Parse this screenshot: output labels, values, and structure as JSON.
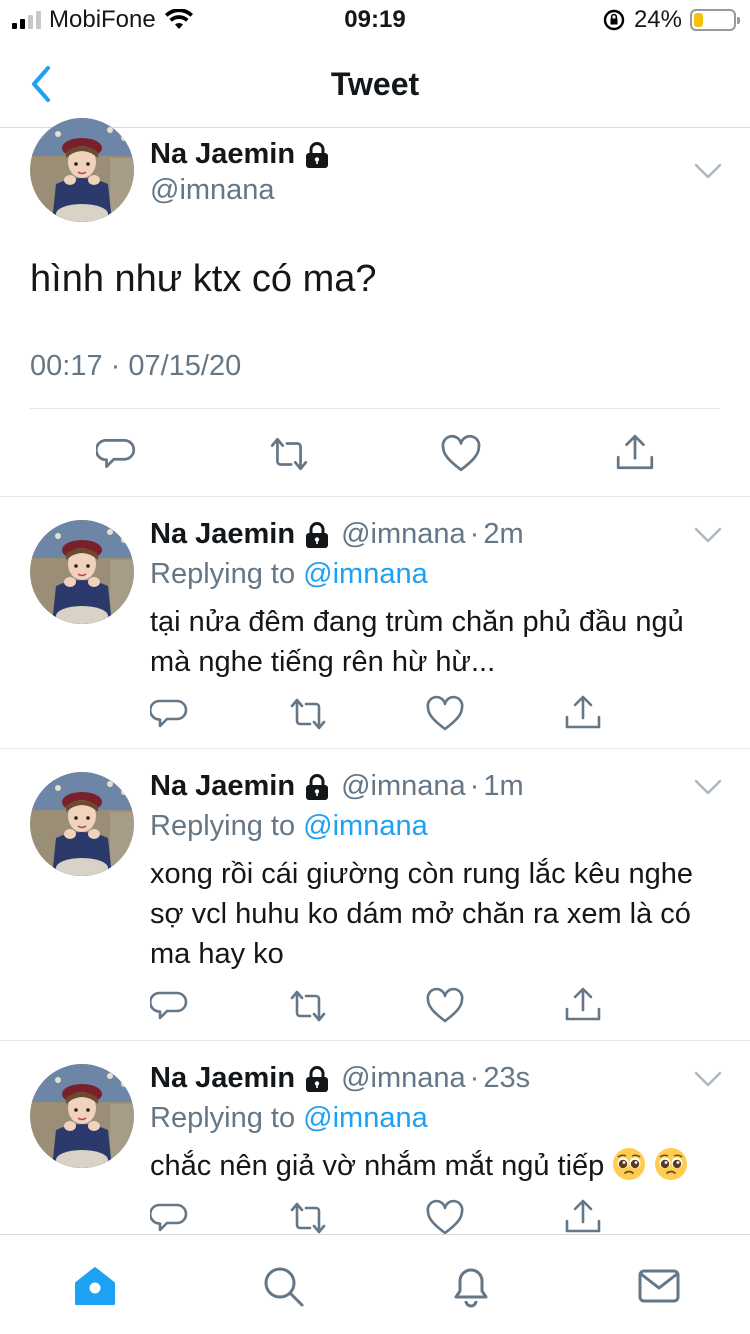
{
  "status_bar": {
    "carrier": "MobiFone",
    "time": "09:19",
    "battery": "24%",
    "battery_level": 0.24
  },
  "nav": {
    "title": "Tweet"
  },
  "main_tweet": {
    "name": "Na Jaemin",
    "handle": "@imnana",
    "text": "hình như ktx có ma?",
    "timestamp": "00:17 · 07/15/20"
  },
  "replies": [
    {
      "name": "Na Jaemin",
      "handle": "@imnana",
      "age": "2m",
      "replying_prefix": "Replying to",
      "replying_to": "@imnana",
      "text": "tại nửa đêm đang trùm chăn phủ đầu ngủ mà nghe tiếng rên hừ hừ..."
    },
    {
      "name": "Na Jaemin",
      "handle": "@imnana",
      "age": "1m",
      "replying_prefix": "Replying to",
      "replying_to": "@imnana",
      "text": "xong rồi cái giường còn rung lắc kêu nghe sợ vcl huhu ko dám mở chăn ra xem là có ma hay ko"
    },
    {
      "name": "Na Jaemin",
      "handle": "@imnana",
      "age": "23s",
      "replying_prefix": "Replying to",
      "replying_to": "@imnana",
      "text": "chắc nên giả vờ nhắm mắt ngủ tiếp"
    }
  ],
  "icons": [
    "back-chevron-icon",
    "lock-icon",
    "chevron-down-icon",
    "reply-icon",
    "retweet-icon",
    "like-icon",
    "share-icon",
    "home-icon",
    "search-icon",
    "notifications-icon",
    "messages-icon",
    "pleading-face-emoji"
  ],
  "colors": {
    "accent": "#1da1f2",
    "muted": "#657786",
    "text": "#14171a",
    "divider": "#e1e8ed"
  }
}
